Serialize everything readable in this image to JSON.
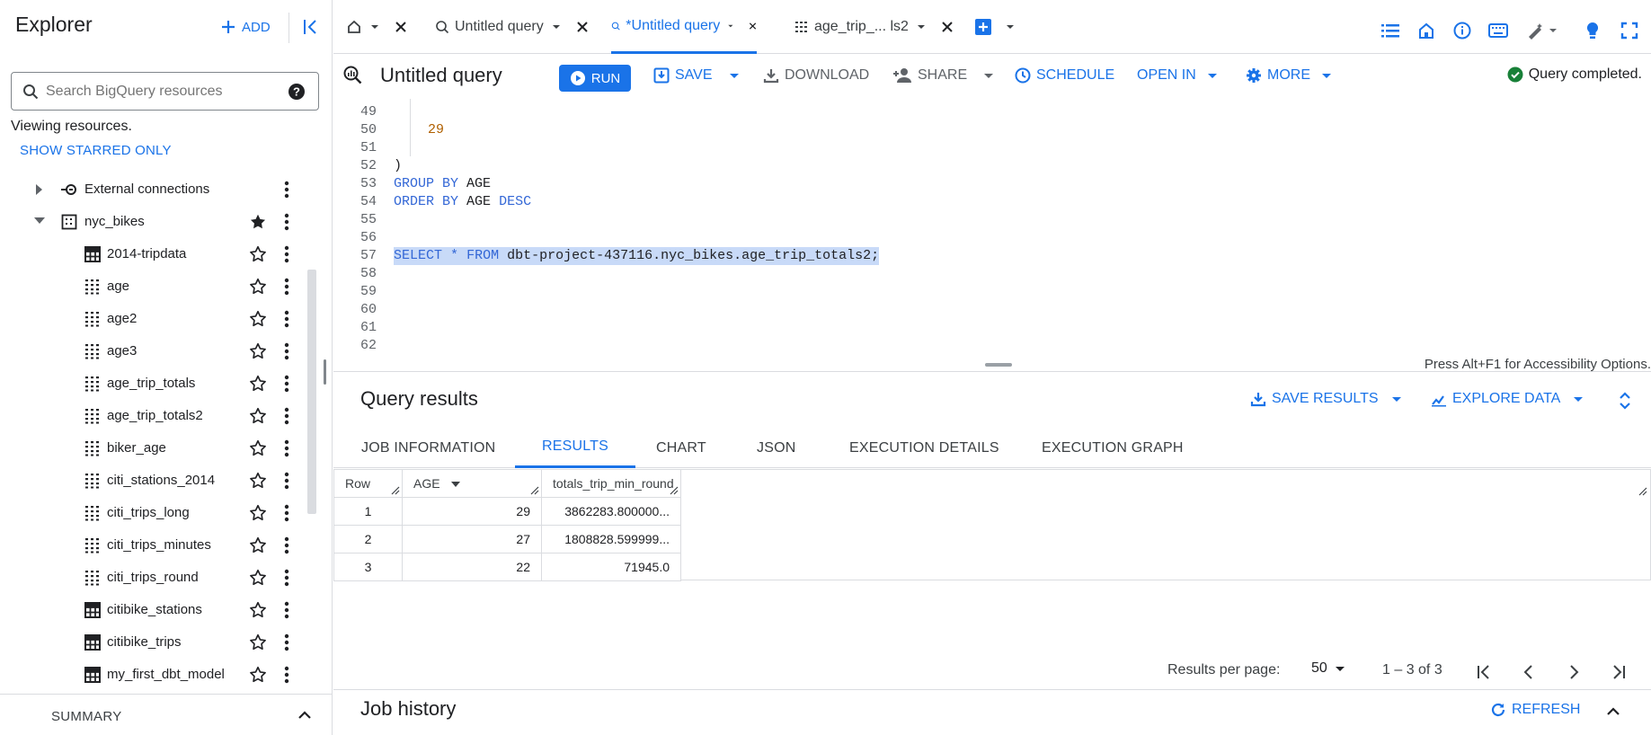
{
  "sidebar": {
    "title": "Explorer",
    "add_label": "ADD",
    "search_placeholder": "Search BigQuery resources",
    "viewing_text": "Viewing resources.",
    "show_starred_label": "SHOW STARRED ONLY",
    "items": [
      {
        "label": "External connections",
        "type": "connections",
        "starred": false
      },
      {
        "label": "nyc_bikes",
        "type": "dataset",
        "starred": true
      },
      {
        "label": "2014-tripdata",
        "type": "table",
        "starred": false
      },
      {
        "label": "age",
        "type": "view",
        "starred": false
      },
      {
        "label": "age2",
        "type": "view",
        "starred": false
      },
      {
        "label": "age3",
        "type": "view",
        "starred": false
      },
      {
        "label": "age_trip_totals",
        "type": "view",
        "starred": false
      },
      {
        "label": "age_trip_totals2",
        "type": "view",
        "starred": false
      },
      {
        "label": "biker_age",
        "type": "view",
        "starred": false
      },
      {
        "label": "citi_stations_2014",
        "type": "view",
        "starred": false
      },
      {
        "label": "citi_trips_long",
        "type": "view",
        "starred": false
      },
      {
        "label": "citi_trips_minutes",
        "type": "view",
        "starred": false
      },
      {
        "label": "citi_trips_round",
        "type": "view",
        "starred": false
      },
      {
        "label": "citibike_stations",
        "type": "table",
        "starred": false
      },
      {
        "label": "citibike_trips",
        "type": "table",
        "starred": false
      },
      {
        "label": "my_first_dbt_model",
        "type": "table",
        "starred": false
      }
    ],
    "summary_label": "SUMMARY"
  },
  "tabs": [
    {
      "label": "Untitled query",
      "active": false
    },
    {
      "label": "*Untitled query",
      "active": true
    },
    {
      "label": "age_trip_... ls2",
      "active": false
    }
  ],
  "toolbar": {
    "title": "Untitled query",
    "run_label": "RUN",
    "save_label": "SAVE",
    "download_label": "DOWNLOAD",
    "share_label": "SHARE",
    "schedule_label": "SCHEDULE",
    "open_in_label": "OPEN IN",
    "more_label": "MORE",
    "status": "Query completed."
  },
  "editor": {
    "lines": [
      {
        "n": "49",
        "text": ""
      },
      {
        "n": "50",
        "text": "29"
      },
      {
        "n": "51",
        "text": ""
      },
      {
        "n": "52",
        "text": ")"
      },
      {
        "n": "53",
        "text": "GROUP BY AGE"
      },
      {
        "n": "54",
        "text": "ORDER BY AGE DESC"
      },
      {
        "n": "55",
        "text": ""
      },
      {
        "n": "56",
        "text": ""
      },
      {
        "n": "57",
        "text": "SELECT * FROM dbt-project-437116.nyc_bikes.age_trip_totals2;"
      },
      {
        "n": "58",
        "text": ""
      },
      {
        "n": "59",
        "text": ""
      },
      {
        "n": "60",
        "text": ""
      },
      {
        "n": "61",
        "text": ""
      },
      {
        "n": "62",
        "text": ""
      }
    ],
    "accessibility_hint": "Press Alt+F1 for Accessibility Options."
  },
  "results": {
    "title": "Query results",
    "save_results_label": "SAVE RESULTS",
    "explore_data_label": "EXPLORE DATA",
    "tabs": [
      {
        "label": "JOB INFORMATION",
        "active": false
      },
      {
        "label": "RESULTS",
        "active": true
      },
      {
        "label": "CHART",
        "active": false
      },
      {
        "label": "JSON",
        "active": false
      },
      {
        "label": "EXECUTION DETAILS",
        "active": false
      },
      {
        "label": "EXECUTION GRAPH",
        "active": false
      }
    ],
    "columns": [
      "Row",
      "AGE",
      "totals_trip_min_round"
    ],
    "rows": [
      [
        "1",
        "29",
        "3862283.800000..."
      ],
      [
        "2",
        "27",
        "1808828.599999..."
      ],
      [
        "3",
        "22",
        "71945.0"
      ]
    ],
    "results_per_page_label": "Results per page:",
    "page_size": "50",
    "range_text": "1 – 3 of 3"
  },
  "job_history": {
    "title": "Job history",
    "refresh_label": "REFRESH"
  },
  "colors": {
    "accent": "#1a73e8",
    "success": "#188038",
    "selection": "#c8daf8"
  }
}
